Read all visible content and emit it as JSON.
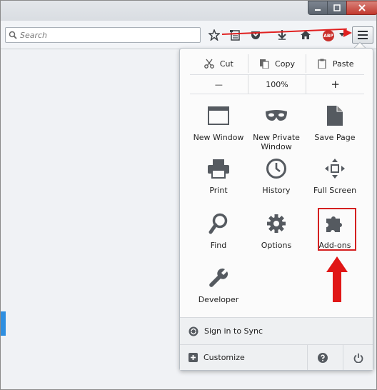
{
  "browser": {
    "search_placeholder": "Search",
    "abp_label": "ABP"
  },
  "edit_row": {
    "cut": "Cut",
    "copy": "Copy",
    "paste": "Paste"
  },
  "zoom_row": {
    "zoom_out": "—",
    "zoom_level": "100%",
    "zoom_in": "+"
  },
  "menu_items": [
    {
      "label": "New Window",
      "icon": "window-icon"
    },
    {
      "label": "New Private\nWindow",
      "icon": "mask-icon"
    },
    {
      "label": "Save Page",
      "icon": "page-icon"
    },
    {
      "label": "Print",
      "icon": "printer-icon"
    },
    {
      "label": "History",
      "icon": "clock-icon"
    },
    {
      "label": "Full Screen",
      "icon": "fullscreen-icon"
    },
    {
      "label": "Find",
      "icon": "magnifier-icon"
    },
    {
      "label": "Options",
      "icon": "gear-icon"
    },
    {
      "label": "Add-ons",
      "icon": "puzzle-icon"
    },
    {
      "label": "Developer",
      "icon": "wrench-icon"
    }
  ],
  "footer": {
    "sync_label": "Sign in to Sync",
    "customize_label": "Customize"
  },
  "colors": {
    "highlight": "#d42020",
    "icon_gray": "#555a60"
  }
}
